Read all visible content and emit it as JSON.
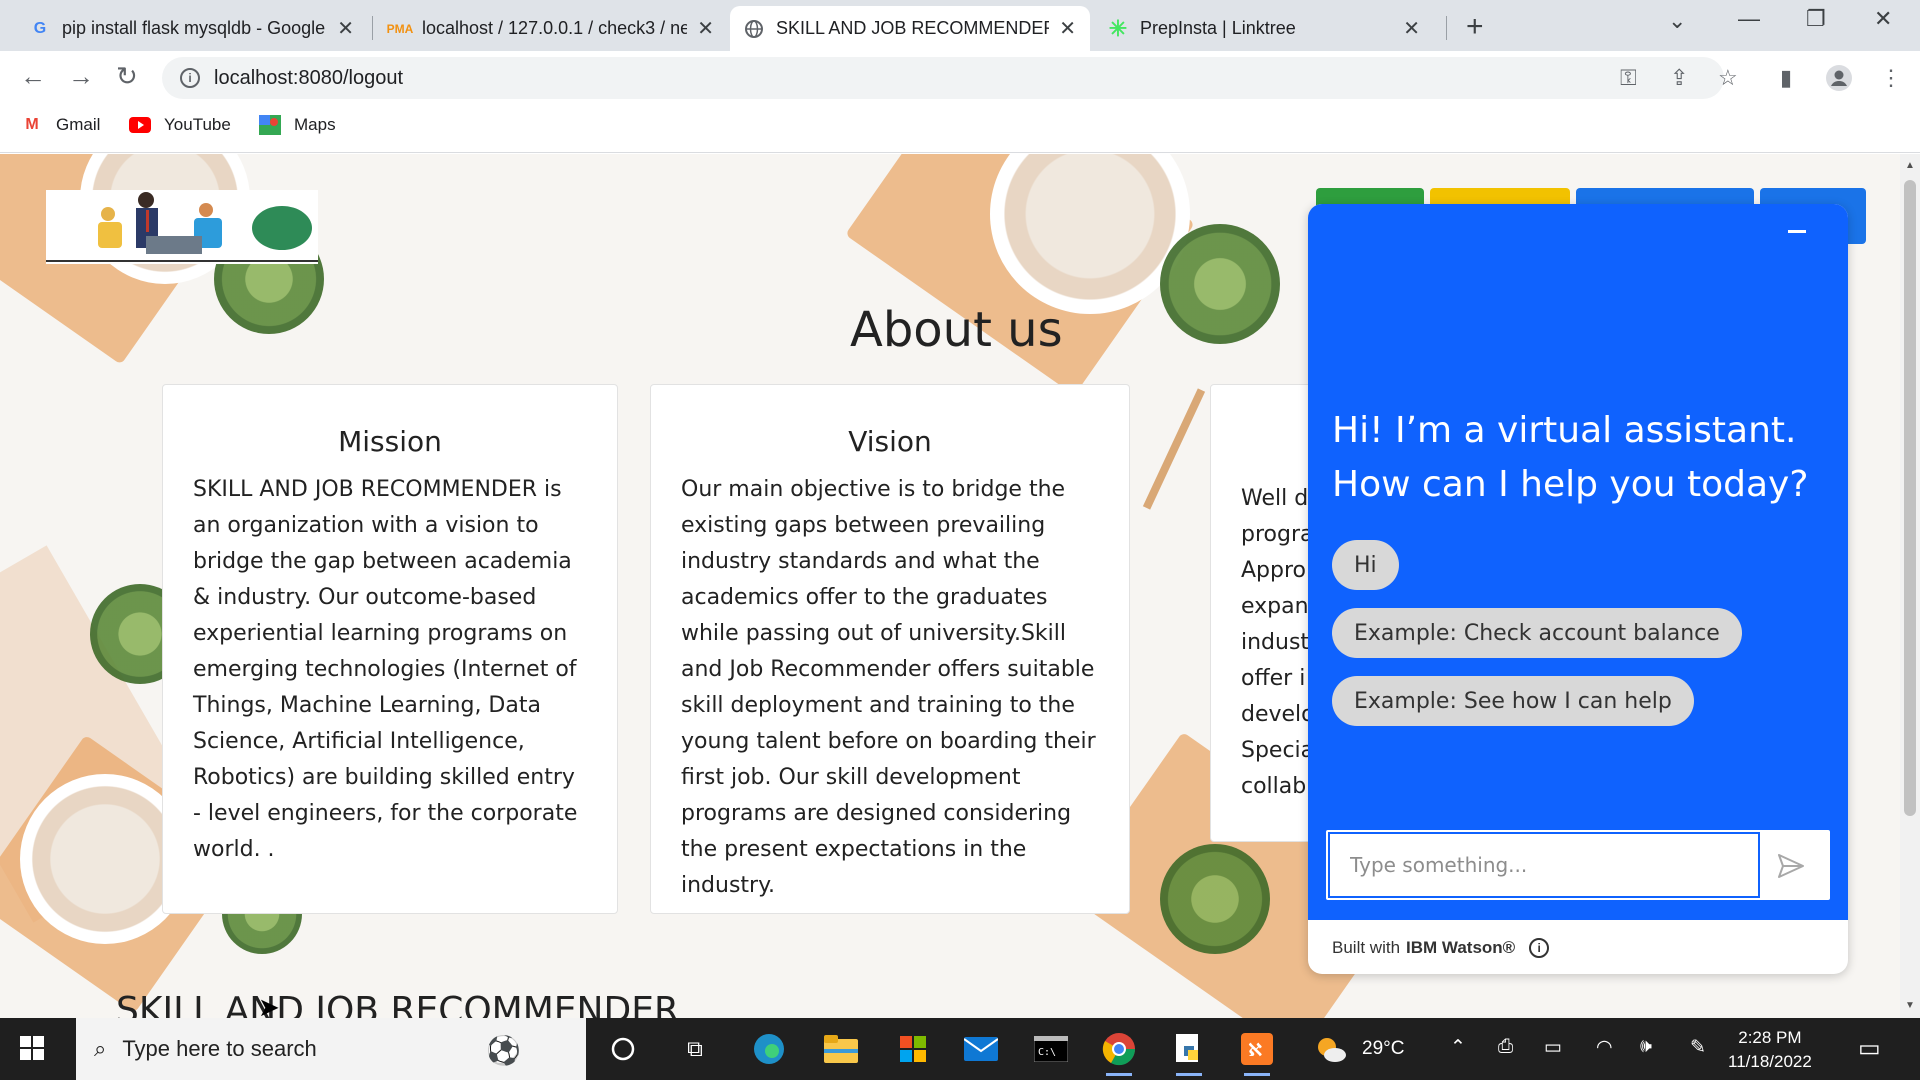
{
  "browser": {
    "tabs": [
      {
        "title": "pip install flask mysqldb - Google",
        "icon": "google-icon"
      },
      {
        "title": "localhost / 127.0.0.1 / check3 / ne",
        "icon": "phpmyadmin-icon"
      },
      {
        "title": "SKILL AND JOB RECOMMENDER|",
        "icon": "globe-icon"
      },
      {
        "title": "PrepInsta | Linktree",
        "icon": "linktree-icon"
      }
    ],
    "url": "localhost:8080/logout",
    "bookmarks": [
      {
        "label": "Gmail",
        "icon": "gmail-icon"
      },
      {
        "label": "YouTube",
        "icon": "youtube-icon"
      },
      {
        "label": "Maps",
        "icon": "maps-icon"
      }
    ]
  },
  "page": {
    "about_title": "About us",
    "cards": [
      {
        "title": "Mission",
        "text": "SKILL AND JOB RECOMMENDER is an organization with a vision to bridge the gap between academia & industry. Our outcome-based experiential learning programs on emerging technologies (Internet of Things, Machine Learning, Data Science, Artificial Intelligence, Robotics) are building skilled entry - level engineers, for the corporate world. ."
      },
      {
        "title": "Vision",
        "text": "Our main objective is to bridge the existing gaps between prevailing industry standards and what the academics offer to the graduates while passing out of university.Skill and Job Recommender offers suitable skill deployment and training to the young talent before on boarding their first job. Our skill development programs are designed considering the present expectations in the industry."
      },
      {
        "title": "",
        "text": "Well d\nprogra\nAppro\nexpan\nindust\noffer i\ndevelo\nSpecia\ncollab"
      }
    ],
    "bottom_heading": "SKILL AND JOB RECOMMENDER",
    "nav_button_colors": [
      "#2e9e3e",
      "#f2c200",
      "#1a73e8",
      "#1a73e8"
    ]
  },
  "chat": {
    "greeting": "Hi! I’m a virtual assistant. How can I help you today?",
    "chips": [
      "Hi",
      "Example: Check account balance",
      "Example: See how I can help"
    ],
    "input_placeholder": "Type something...",
    "footer_prefix": "Built with",
    "footer_brand": "IBM Watson®",
    "accent": "#0f62fe"
  },
  "taskbar": {
    "search_placeholder": "Type here to search",
    "weather": "29°C",
    "time": "2:28 PM",
    "date": "11/18/2022"
  }
}
